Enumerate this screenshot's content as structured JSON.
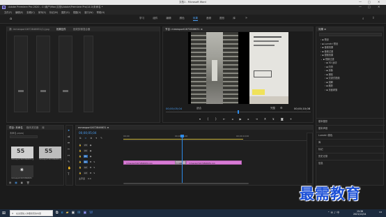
{
  "word_titlebar": {
    "title": "文档1 - Microsoft Word"
  },
  "pr_titlebar": {
    "title": "Adobe Premiere Pro 2020 - C:\\用户\\Mac\\文档\\Adobe\\Premiere Pro\\14.0\\未命名 *"
  },
  "menu": {
    "items": [
      "文件(F)",
      "编辑(E)",
      "剪辑(C)",
      "序列(S)",
      "标记(M)",
      "图形(G)",
      "视图(V)",
      "窗口(W)",
      "帮助(H)"
    ]
  },
  "workspaces": {
    "items": [
      "学习",
      "组件",
      "编辑",
      "颜色",
      "效果",
      "音频",
      "图形",
      "库"
    ],
    "active_index": 4
  },
  "source_panel": {
    "tabs": [
      "源: mmexport1672846651(1).jpg",
      "效果控件",
      "音频剪辑混合器"
    ]
  },
  "program_monitor": {
    "tab": "节目: mmexport1672846631 ≡",
    "timecode_current": "00;00;05;04",
    "fit_label": "适合",
    "quality_label": "完整",
    "timecode_total": "00;00;10;08"
  },
  "project_panel": {
    "tabs": [
      "项目: 未命名",
      "媒体浏览器",
      "库"
    ],
    "file_name": "未命名.prproj",
    "thumbs": [
      {
        "label": "mmexport1672846631.jpg"
      },
      {
        "label": "mmexport1672846651.jpg"
      },
      {
        "label": "mmexport1672846631"
      }
    ]
  },
  "timeline": {
    "tab": "mmexport1672846631 ≡",
    "timecode": "00;00;05;04",
    "ruler": [
      "00;00",
      "00;00;05;00",
      "00;00;10;00"
    ],
    "tracks": [
      "V3",
      "V2",
      "V1",
      "A1",
      "A2",
      "A3"
    ],
    "master_label": "主声道",
    "master_value": "0.0",
    "clips": [
      {
        "label": "mmexport1672846631.jpg"
      },
      {
        "label": "mmexport1672846651.jpg"
      }
    ],
    "transition_label": "交叉溶解"
  },
  "effects_panel": {
    "tab": "效果 ≡",
    "tree": [
      "预设",
      "Lumetri 预设",
      "音频效果",
      "音频过渡",
      "视频效果",
      "视频过渡",
      "3D 运动",
      "内滑",
      "划像",
      "擦除",
      "沉浸式视频",
      "溶解",
      "缩放",
      "页面剥落"
    ],
    "bottom_items": [
      "基本图形",
      "基本声音",
      "Lumetri 颜色",
      "库",
      "标记",
      "历史记录",
      "信息"
    ]
  },
  "taskbar": {
    "search": "在这里输入你要搜索的内容",
    "time": "15:36",
    "date": "2021/12/24"
  },
  "watermark": "最需教育",
  "colors": {
    "clip": "#d87bd5",
    "playhead": "#2d8ceb",
    "accent": "#4a9ff5"
  }
}
